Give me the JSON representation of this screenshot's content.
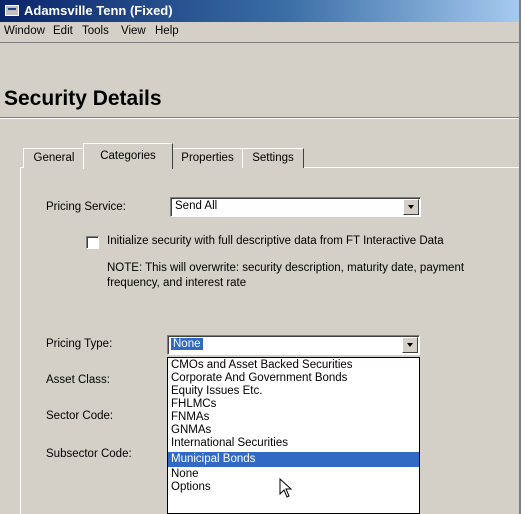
{
  "window": {
    "title": "Adamsville Tenn (Fixed)",
    "icon": "app-window-icon"
  },
  "menubar": {
    "items": [
      "Window",
      "Edit",
      "Tools",
      "View",
      "Help"
    ]
  },
  "page": {
    "title": "Security Details"
  },
  "tabs": {
    "items": [
      "General",
      "Categories",
      "Properties",
      "Settings"
    ],
    "active": "Categories"
  },
  "form": {
    "pricing_service": {
      "label": "Pricing Service:",
      "value": "Send All"
    },
    "initialize_checkbox": {
      "label": "Initialize security with full descriptive data from FT Interactive Data",
      "checked": false
    },
    "note": {
      "line1": "NOTE: This will overwrite: security description, maturity date, payment",
      "line2": "frequency, and interest rate"
    },
    "pricing_type": {
      "label": "Pricing Type:",
      "value": "None"
    },
    "asset_class": {
      "label": "Asset Class:"
    },
    "sector_code": {
      "label": "Sector Code:"
    },
    "subsector_code": {
      "label": "Subsector Code:"
    }
  },
  "dropdown": {
    "options": [
      "CMOs and Asset Backed Securities",
      "Corporate And Government Bonds",
      "Equity Issues Etc.",
      "FHLMCs",
      "FNMAs",
      "GNMAs",
      "International Securities",
      "Municipal Bonds",
      "None",
      "Options"
    ],
    "highlighted": "Municipal Bonds"
  },
  "colors": {
    "titlebar_start": "#0a246a",
    "titlebar_end": "#a6caf0",
    "selection": "#316ac5",
    "face": "#d4d0c8"
  }
}
